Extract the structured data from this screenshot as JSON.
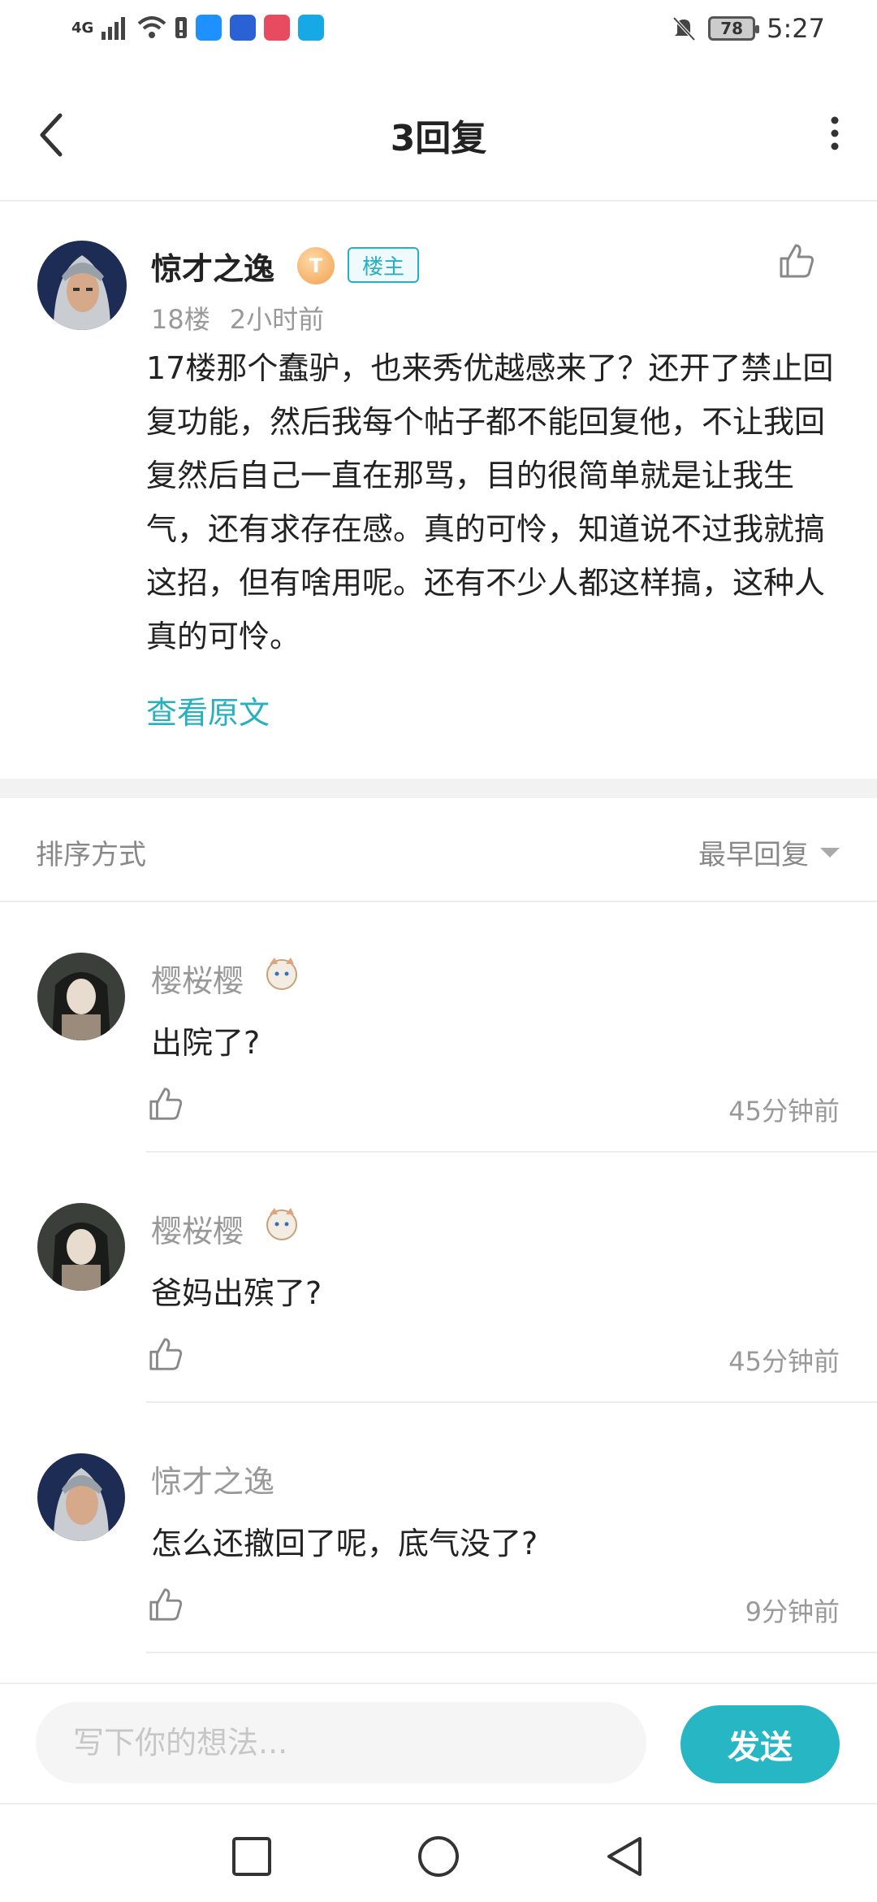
{
  "status_bar": {
    "network": "4G",
    "battery": "78",
    "time": "5:27"
  },
  "nav": {
    "title": "3回复"
  },
  "post": {
    "author": "惊才之逸",
    "level": "T",
    "owner_badge": "楼主",
    "floor": "18楼",
    "time": "2小时前",
    "content": "17楼那个蠢驴，也来秀优越感来了？还开了禁止回复功能，然后我每个帖子都不能回复他，不让我回复然后自己一直在那骂，目的很简单就是让我生气，还有求存在感。真的可怜，知道说不过我就搞这招，但有啥用呢。还有不少人都这样搞，这种人真的可怜。",
    "view_original": "查看原文"
  },
  "sort": {
    "label": "排序方式",
    "selected": "最早回复"
  },
  "replies": [
    {
      "author": "樱桜樱",
      "text": "出院了?",
      "time": "45分钟前"
    },
    {
      "author": "樱桜樱",
      "text": "爸妈出殡了?",
      "time": "45分钟前"
    },
    {
      "author": "惊才之逸",
      "text": "怎么还撤回了呢，底气没了?",
      "time": "9分钟前"
    }
  ],
  "composer": {
    "placeholder": "写下你的想法...",
    "send_label": "发送"
  },
  "colors": {
    "accent": "#27b6c4",
    "text_primary": "#222222",
    "text_secondary": "#999999"
  }
}
